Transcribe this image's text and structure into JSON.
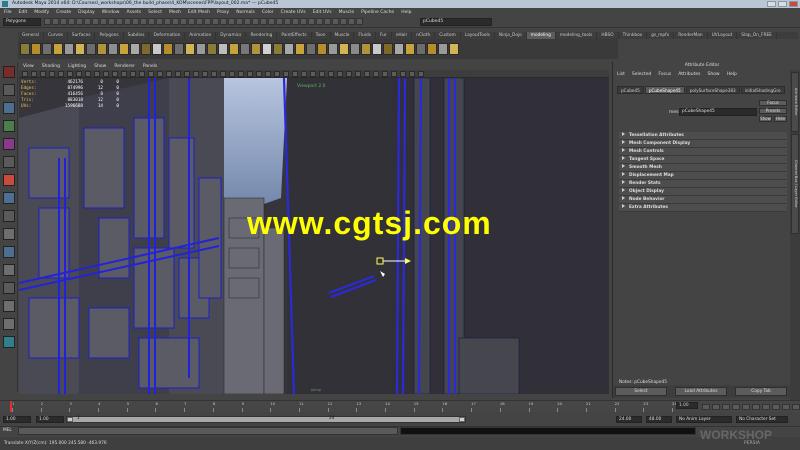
{
  "window": {
    "title": "Autodesk Maya 2014 x64: D:\\Courses\\_workshops\\06_the build_phase\\4_KOM\\scenes\\FPP\\layout_002.ma* --- pCube45"
  },
  "menubar": {
    "items": [
      "File",
      "Edit",
      "Modify",
      "Create",
      "Display",
      "Window",
      "Assets",
      "Select",
      "Mesh",
      "Edit Mesh",
      "Proxy",
      "Normals",
      "Color",
      "Create UVs",
      "Edit UVs",
      "Muscle",
      "Pipeline Cache",
      "Help"
    ]
  },
  "statusline": {
    "mode": "Polygons",
    "name_field": "pCube45"
  },
  "shelf": {
    "tabs": [
      "General",
      "Curves",
      "Surfaces",
      "Polygons",
      "Subdivs",
      "Deformation",
      "Animation",
      "Dynamics",
      "Rendering",
      "PaintEffects",
      "Toon",
      "Muscle",
      "Fluids",
      "Fur",
      "nHair",
      "nCloth",
      "Custom",
      "LayoutTools",
      "Ninja_Dojo",
      "modeling",
      "modeling_tools",
      "HBSO",
      "Thinkbox",
      "gs_mpfx",
      "RenderMan",
      "UVLayout",
      "Slap_On_FREE"
    ],
    "active_tab": "modeling",
    "icon_colors": [
      "#8a7b3a",
      "#b68d2d",
      "#6e6e6e",
      "#c7a33c",
      "#9a9a9a",
      "#d2b356",
      "#6c6c6c",
      "#b0943d",
      "#8e8e8e",
      "#c7a33c",
      "#a8a8a8",
      "#7d6a2a",
      "#c9c9c9",
      "#b68d2d",
      "#6e6e6e",
      "#d2b356",
      "#9a9a9a",
      "#8a7b3a",
      "#bcbcbc",
      "#c7a33c",
      "#777777",
      "#b0943d",
      "#d0d0d0",
      "#8a7b3a",
      "#a8a8a8",
      "#c7a33c",
      "#6e6e6e",
      "#b68d2d",
      "#9a9a9a",
      "#d2b356",
      "#8a8a8a",
      "#b0943d",
      "#c9c9c9",
      "#7d6a2a",
      "#a8a8a8",
      "#c7a33c",
      "#6c6c6c",
      "#b68d2d",
      "#9a9a9a",
      "#d2b356"
    ]
  },
  "toolbox": {
    "tool_colors": [
      "#7a2b2b",
      "#5a5a5a",
      "#4e6f91",
      "#4b7f4b",
      "#8a3a8a",
      "#5a5a5a",
      "#c84b3b",
      "#4e6f91",
      "#5a5a5a",
      "#6e6e6e",
      "#4e6f91",
      "#6e6e6e",
      "#5a5a5a",
      "#6e6e6e",
      "#6e6e6e",
      "#2f7f8f"
    ]
  },
  "viewport": {
    "menu": [
      "View",
      "Shading",
      "Lighting",
      "Show",
      "Renderer",
      "Panels"
    ],
    "label": "Viewport 2.0",
    "axis_label": "persp",
    "hud": [
      {
        "label": "Verts:",
        "v1": "462176",
        "v2": "0",
        "v3": "0"
      },
      {
        "label": "Edges:",
        "v1": "874996",
        "v2": "12",
        "v3": "0"
      },
      {
        "label": "Faces:",
        "v1": "416456",
        "v2": "8",
        "v3": "0"
      },
      {
        "label": "Tris:",
        "v1": "883018",
        "v2": "12",
        "v3": "0"
      },
      {
        "label": "UVs:",
        "v1": "1596688",
        "v2": "14",
        "v3": "0"
      }
    ],
    "watermark": "www.cgtsj.com"
  },
  "side_tabs": [
    "Attribute Editor",
    "Channel Box / Layer Editor"
  ],
  "attribute_editor": {
    "title": "Attribute Editor",
    "menu": [
      "List",
      "Selected",
      "Focus",
      "Attributes",
      "Show",
      "Help"
    ],
    "tabs": [
      "pCube45",
      "pCubeShape45",
      "polySurfaceShape383",
      "initialShadingGro"
    ],
    "active_tab": "pCubeShape45",
    "focus_button": "Focus",
    "presets_button": "Presets",
    "show_button": "Show",
    "hide_button": "Hide",
    "mesh_label": "mesh:",
    "mesh_value": "pCubeShape45",
    "sections": [
      "Tessellation Attributes",
      "Mesh Component Display",
      "Mesh Controls",
      "Tangent Space",
      "Smooth Mesh",
      "Displacement Map",
      "Render Stats",
      "Object Display",
      "Node Behavior",
      "Extra Attributes"
    ],
    "notes_label": "Notes: pCubeShape45",
    "buttons": [
      "Select",
      "Load Attributes",
      "Copy Tab"
    ]
  },
  "timeslider": {
    "ticks": [
      "1",
      "2",
      "3",
      "4",
      "5",
      "6",
      "7",
      "8",
      "9",
      "10",
      "11",
      "12",
      "13",
      "14",
      "15",
      "16",
      "17",
      "18",
      "19",
      "20",
      "21",
      "22",
      "23",
      "24"
    ],
    "current_frame": "1.00"
  },
  "rangeslider": {
    "start": "1.00",
    "start_inner": "1.00",
    "range_start_label": "1",
    "range_end_label": "24",
    "end_inner": "24.00",
    "end": "48.00",
    "anim_layer": "No Anim Layer",
    "char_set": "No Character Set"
  },
  "commandline": {
    "lang": "MEL"
  },
  "helpline": {
    "text": "Translate X/Y/Z(cm): 195.000   245.580   -463.976"
  },
  "branding": {
    "logo": "WORKSHOP",
    "small": "PERSIA"
  }
}
